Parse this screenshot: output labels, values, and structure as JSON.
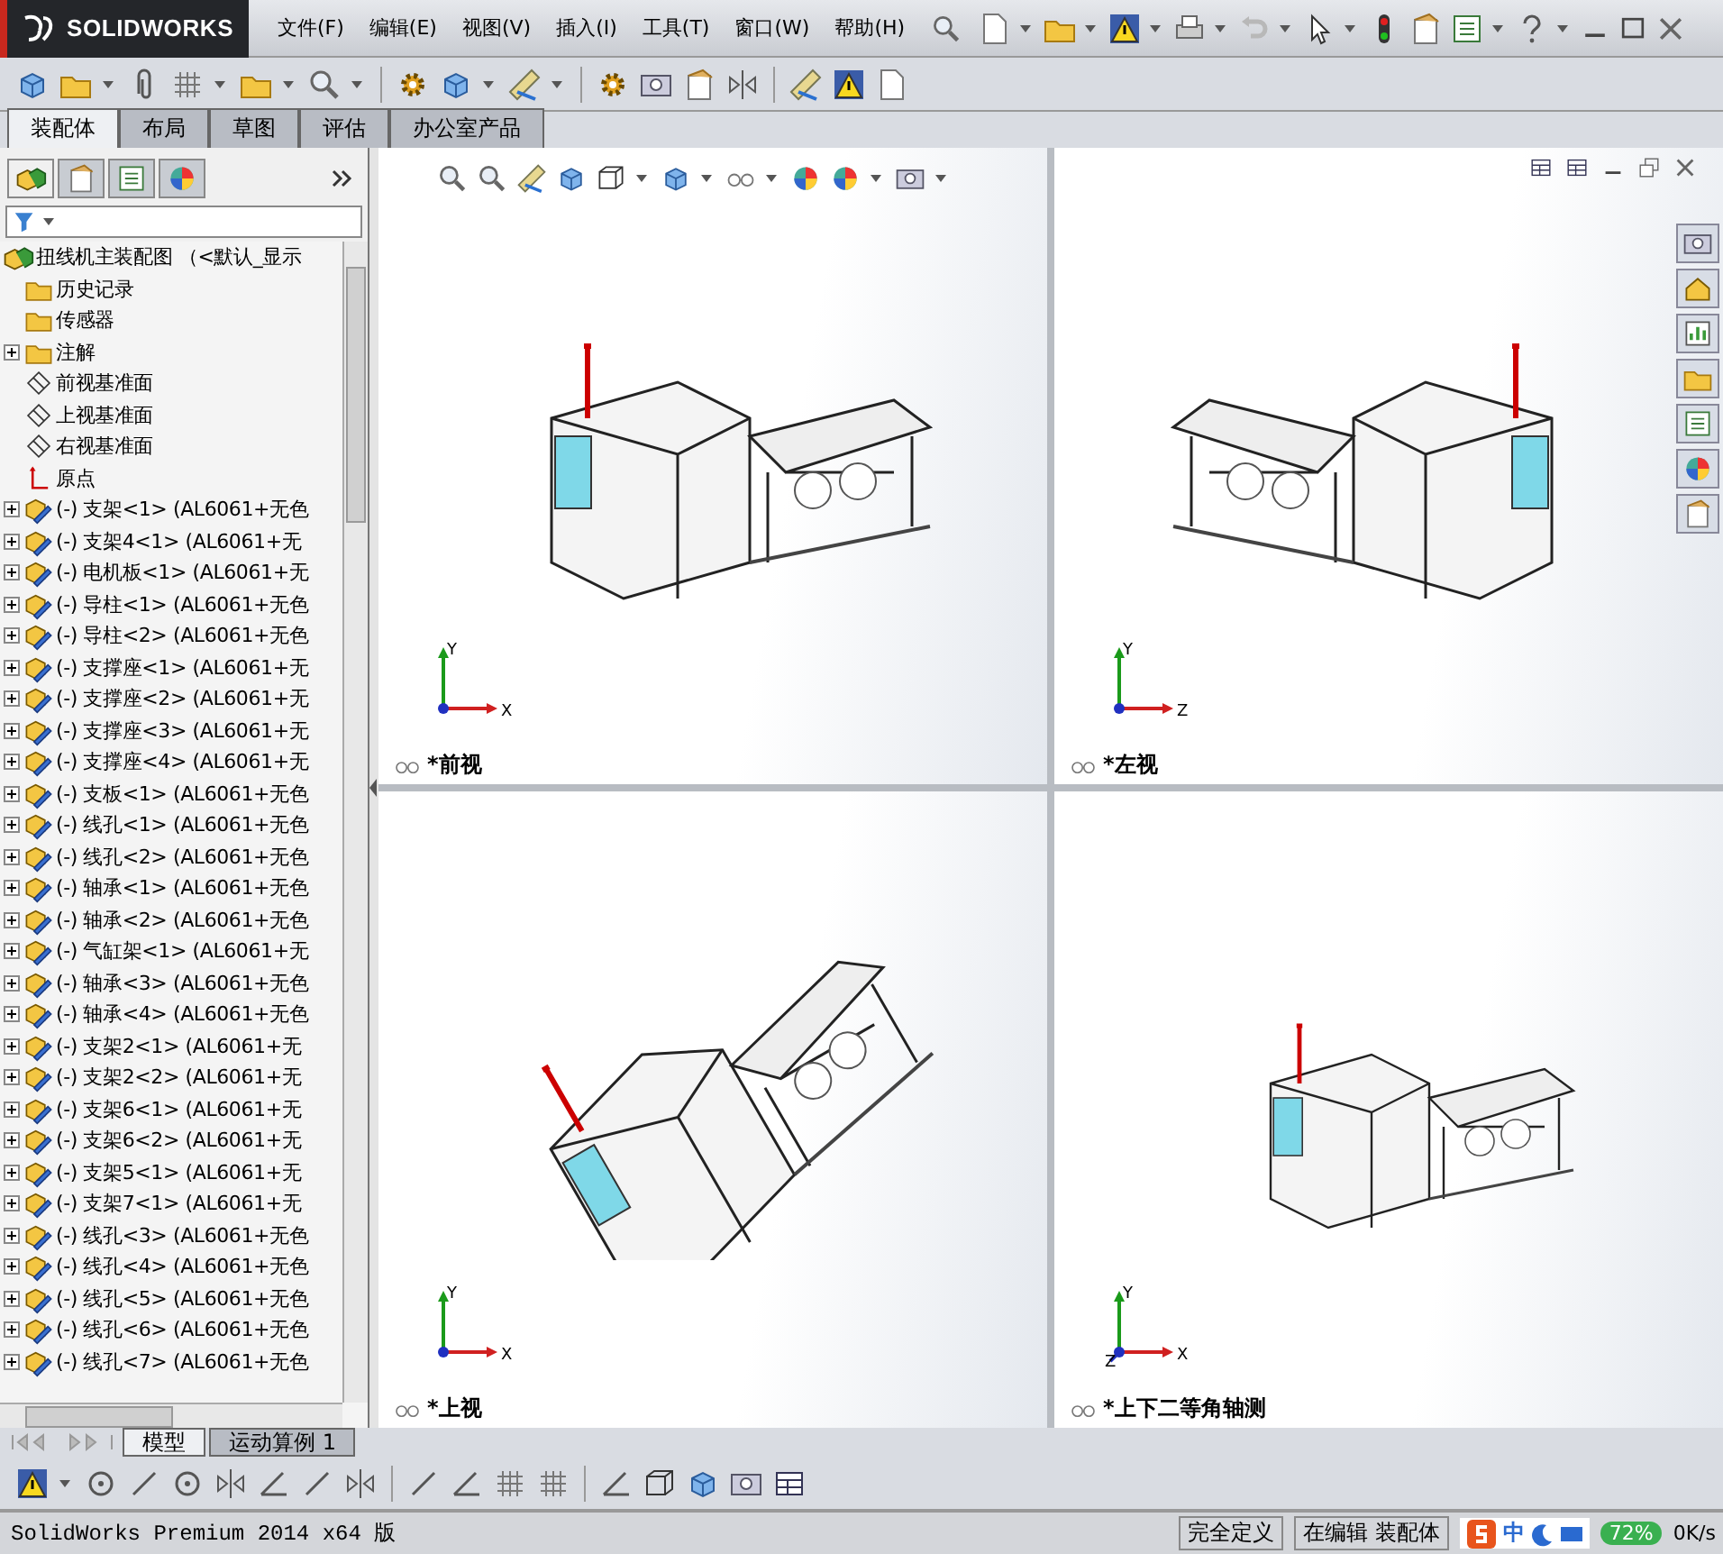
{
  "app": {
    "logo_text": "SOLIDWORKS"
  },
  "menu": [
    "文件(F)",
    "编辑(E)",
    "视图(V)",
    "插入(I)",
    "工具(T)",
    "窗口(W)",
    "帮助(H)"
  ],
  "command_tabs": [
    {
      "label": "装配体",
      "selected": true
    },
    {
      "label": "布局",
      "selected": false
    },
    {
      "label": "草图",
      "selected": false
    },
    {
      "label": "评估",
      "selected": false
    },
    {
      "label": "办公室产品",
      "selected": false
    }
  ],
  "panel_tabs": [
    {
      "selected": true
    },
    {
      "selected": false
    },
    {
      "selected": false
    },
    {
      "selected": false
    }
  ],
  "feature_tree": {
    "root": "扭线机主装配图 （<默认_显示",
    "items": [
      {
        "kind": "history",
        "label": "历史记录",
        "expandable": false
      },
      {
        "kind": "sensor",
        "label": "传感器",
        "expandable": false
      },
      {
        "kind": "annotation",
        "label": "注解",
        "expandable": true
      },
      {
        "kind": "plane",
        "label": "前视基准面",
        "expandable": false
      },
      {
        "kind": "plane",
        "label": "上视基准面",
        "expandable": false
      },
      {
        "kind": "plane",
        "label": "右视基准面",
        "expandable": false
      },
      {
        "kind": "origin",
        "label": "原点",
        "expandable": false
      },
      {
        "kind": "component",
        "label": "(-) 支架<1> (AL6061+无色",
        "expandable": true
      },
      {
        "kind": "component",
        "label": "(-) 支架4<1> (AL6061+无",
        "expandable": true
      },
      {
        "kind": "component",
        "label": "(-) 电机板<1> (AL6061+无",
        "expandable": true
      },
      {
        "kind": "component",
        "label": "(-) 导柱<1> (AL6061+无色",
        "expandable": true
      },
      {
        "kind": "component",
        "label": "(-) 导柱<2> (AL6061+无色",
        "expandable": true
      },
      {
        "kind": "component",
        "label": "(-) 支撑座<1> (AL6061+无",
        "expandable": true
      },
      {
        "kind": "component",
        "label": "(-) 支撑座<2> (AL6061+无",
        "expandable": true
      },
      {
        "kind": "component",
        "label": "(-) 支撑座<3> (AL6061+无",
        "expandable": true
      },
      {
        "kind": "component",
        "label": "(-) 支撑座<4> (AL6061+无",
        "expandable": true
      },
      {
        "kind": "component",
        "label": "(-) 支板<1> (AL6061+无色",
        "expandable": true
      },
      {
        "kind": "component",
        "label": "(-) 线孔<1> (AL6061+无色",
        "expandable": true
      },
      {
        "kind": "component",
        "label": "(-) 线孔<2> (AL6061+无色",
        "expandable": true
      },
      {
        "kind": "component",
        "label": "(-) 轴承<1> (AL6061+无色",
        "expandable": true
      },
      {
        "kind": "component",
        "label": "(-) 轴承<2> (AL6061+无色",
        "expandable": true
      },
      {
        "kind": "component",
        "label": "(-) 气缸架<1> (AL6061+无",
        "expandable": true
      },
      {
        "kind": "component",
        "label": "(-) 轴承<3> (AL6061+无色",
        "expandable": true
      },
      {
        "kind": "component",
        "label": "(-) 轴承<4> (AL6061+无色",
        "expandable": true
      },
      {
        "kind": "component",
        "label": "(-) 支架2<1> (AL6061+无",
        "expandable": true
      },
      {
        "kind": "component",
        "label": "(-) 支架2<2> (AL6061+无",
        "expandable": true
      },
      {
        "kind": "component",
        "label": "(-) 支架6<1> (AL6061+无",
        "expandable": true
      },
      {
        "kind": "component",
        "label": "(-) 支架6<2> (AL6061+无",
        "expandable": true
      },
      {
        "kind": "component",
        "label": "(-) 支架5<1> (AL6061+无",
        "expandable": true
      },
      {
        "kind": "component",
        "label": "(-) 支架7<1> (AL6061+无",
        "expandable": true
      },
      {
        "kind": "component",
        "label": "(-) 线孔<3> (AL6061+无色",
        "expandable": true
      },
      {
        "kind": "component",
        "label": "(-) 线孔<4> (AL6061+无色",
        "expandable": true
      },
      {
        "kind": "component",
        "label": "(-) 线孔<5> (AL6061+无色",
        "expandable": true
      },
      {
        "kind": "component",
        "label": "(-) 线孔<6> (AL6061+无色",
        "expandable": true
      },
      {
        "kind": "component",
        "label": "(-) 线孔<7> (AL6061+无色",
        "expandable": true
      }
    ]
  },
  "viewports": [
    {
      "label": "*前视",
      "axes": [
        "Y",
        "X"
      ]
    },
    {
      "label": "*左视",
      "axes": [
        "Y",
        "Z"
      ]
    },
    {
      "label": "*上视",
      "axes": [
        "Y",
        "X"
      ]
    },
    {
      "label": "*上下二等角轴测",
      "axes": [
        "Y",
        "X",
        "Z"
      ]
    }
  ],
  "bottom_tabs": [
    {
      "label": "模型",
      "selected": true
    },
    {
      "label": "运动算例 1",
      "selected": false
    }
  ],
  "status_bar": {
    "product": "SolidWorks Premium 2014 x64 版",
    "fields": [
      "完全定义",
      "在编辑 装配体"
    ]
  },
  "tray": {
    "ime_mode": "中",
    "cpu": "72%",
    "net_rate": "0K/s"
  }
}
